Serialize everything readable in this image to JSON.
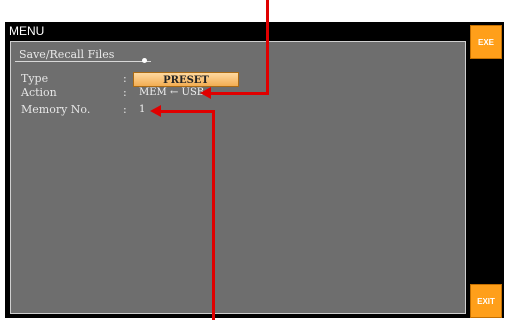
{
  "header": {
    "title": "MENU"
  },
  "panel": {
    "section_title": "Save/Recall Files",
    "rows": [
      {
        "label": "Type",
        "colon": ":",
        "value": "PRESET"
      },
      {
        "label": "Action",
        "colon": ":",
        "value": "MEM ← USB"
      },
      {
        "label": "Memory No.",
        "colon": ":",
        "value": "1"
      }
    ]
  },
  "softkeys": {
    "exe": "EXE",
    "exit": "EXIT"
  },
  "colors": {
    "accent": "#ff9f1a",
    "panel": "#6e6e6e",
    "annotation": "#e00000"
  }
}
